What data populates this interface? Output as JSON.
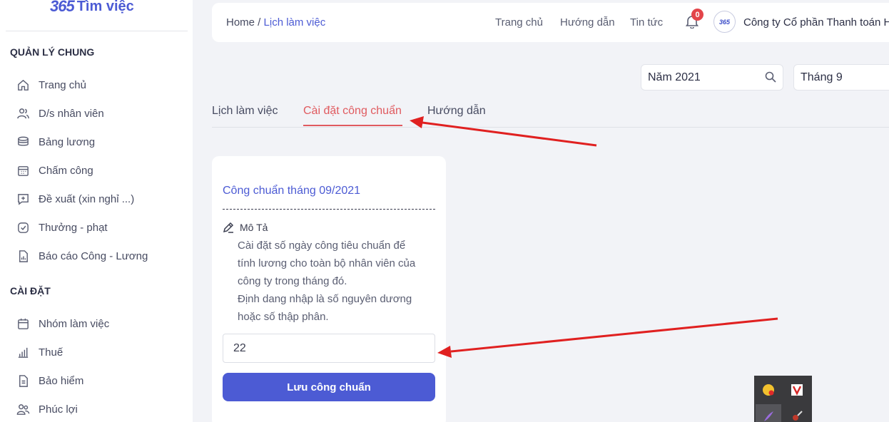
{
  "sidebar": {
    "logo_mark": "365",
    "logo_text": "Tìm việc",
    "sections": [
      {
        "title": "QUẢN LÝ CHUNG",
        "items": [
          {
            "label": "Trang chủ",
            "icon": "home-icon"
          },
          {
            "label": "D/s nhân viên",
            "icon": "users-icon"
          },
          {
            "label": "Bảng lương",
            "icon": "coins-icon"
          },
          {
            "label": "Chấm công",
            "icon": "calendar-grid-icon"
          },
          {
            "label": "Đề xuất (xin nghỉ ...)",
            "icon": "message-plus-icon"
          },
          {
            "label": "Thưởng - phạt",
            "icon": "check-shield-icon"
          },
          {
            "label": "Báo cáo Công - Lương",
            "icon": "report-chart-icon"
          }
        ]
      },
      {
        "title": "CÀI ĐẶT",
        "items": [
          {
            "label": "Nhóm làm việc",
            "icon": "calendar-icon"
          },
          {
            "label": "Thuế",
            "icon": "bar-chart-icon"
          },
          {
            "label": "Bảo hiểm",
            "icon": "document-icon"
          },
          {
            "label": "Phúc lợi",
            "icon": "people-icon"
          }
        ]
      }
    ]
  },
  "header": {
    "breadcrumb_home": "Home /",
    "breadcrumb_current": "Lịch làm việc",
    "links": [
      "Trang chủ",
      "Hướng dẫn",
      "Tin tức"
    ],
    "notification_count": "0",
    "avatar_text": "365",
    "company_name": "Công ty Cổ phần Thanh toán H"
  },
  "filters": {
    "year": "Năm 2021",
    "month": "Tháng 9"
  },
  "tabs": [
    {
      "label": "Lịch làm việc",
      "active": false
    },
    {
      "label": "Cài đặt công chuẩn",
      "active": true
    },
    {
      "label": "Hướng dẫn",
      "active": false
    }
  ],
  "card": {
    "title": "Công chuẩn tháng 09/2021",
    "desc_title": "Mô Tả",
    "desc_lines": [
      "Cài đặt số ngày công tiêu chuẩn để",
      "tính lương cho toàn bộ nhân viên của",
      "công ty trong tháng đó.",
      "Định dang nhập là số nguyên dương",
      "hoặc số thập phân."
    ],
    "input_value": "22",
    "save_label": "Lưu công chuẩn"
  },
  "colors": {
    "accent": "#4c5bd4",
    "active_tab": "#e05a5f",
    "arrow": "#e02020",
    "badge": "#e3454a"
  }
}
